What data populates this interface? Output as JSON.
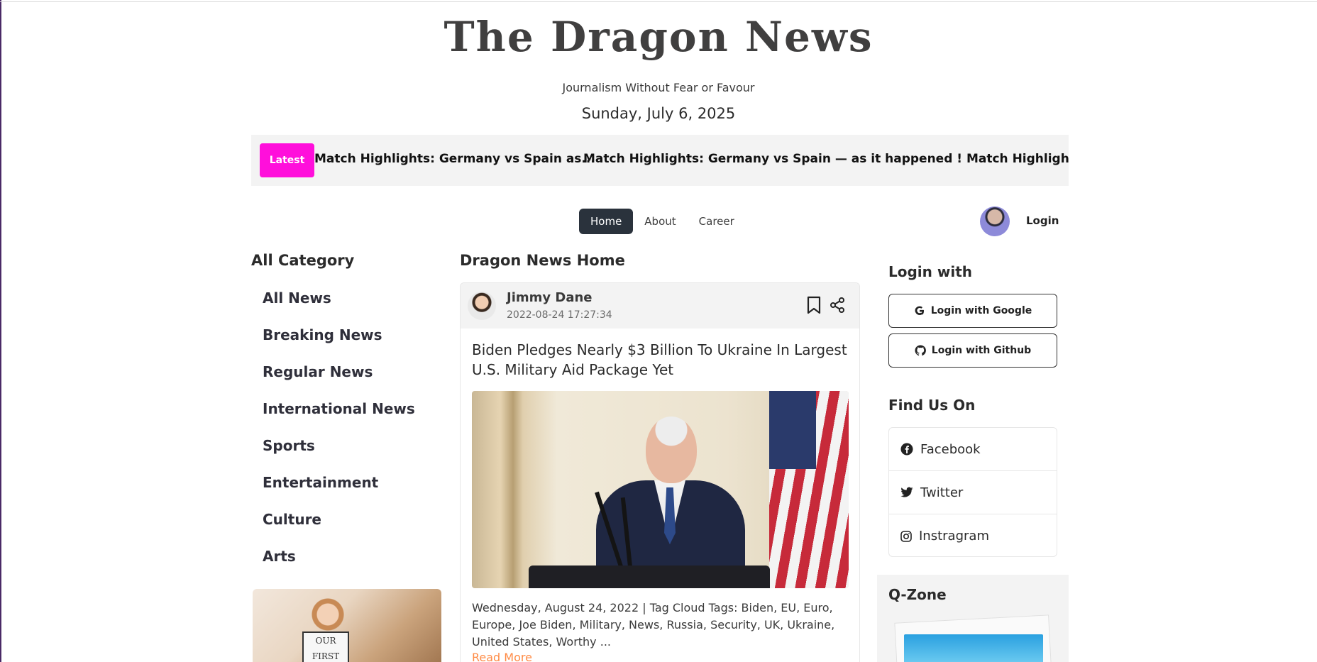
{
  "header": {
    "logo": "The Dragon News",
    "tagline": "Journalism Without Fear or Favour",
    "date": "Sunday, July 6, 2025"
  },
  "latest": {
    "badge": "Latest",
    "headline": "Match Highlights: Germany vs Spain as...",
    "ticker": "Match Highlights: Germany vs Spain — as it happened ! Match Highlights: Germany"
  },
  "nav": {
    "items": [
      {
        "label": "Home",
        "active": true
      },
      {
        "label": "About",
        "active": false
      },
      {
        "label": "Career",
        "active": false
      }
    ],
    "login": "Login"
  },
  "left": {
    "title": "All Category",
    "categories": [
      "All News",
      "Breaking News",
      "Regular News",
      "International News",
      "Sports",
      "Entertainment",
      "Culture",
      "Arts"
    ],
    "image_sign": "OUR FIRST"
  },
  "main": {
    "title": "Dragon News Home",
    "card": {
      "author": "Jimmy Dane",
      "published": "2022-08-24 17:27:34",
      "headline": "Biden Pledges Nearly $3 Billion To Ukraine In Largest U.S. Military Aid Package Yet",
      "description": "Wednesday, August 24, 2022 | Tag Cloud Tags: Biden, EU, Euro, Europe, Joe Biden, Military, News, Russia, Security, UK, Ukraine, United States, Worthy ...",
      "read_more": "Read More"
    }
  },
  "right": {
    "login_title": "Login with",
    "google": "Login with Google",
    "github": "Login with Github",
    "find_title": "Find Us On",
    "social": [
      "Facebook",
      "Twitter",
      "Instragram"
    ],
    "qzone_title": "Q-Zone"
  },
  "colors": {
    "accent": "#FF0FDB",
    "read_more": "#FF8C47",
    "nav_active": "#2a323c"
  }
}
